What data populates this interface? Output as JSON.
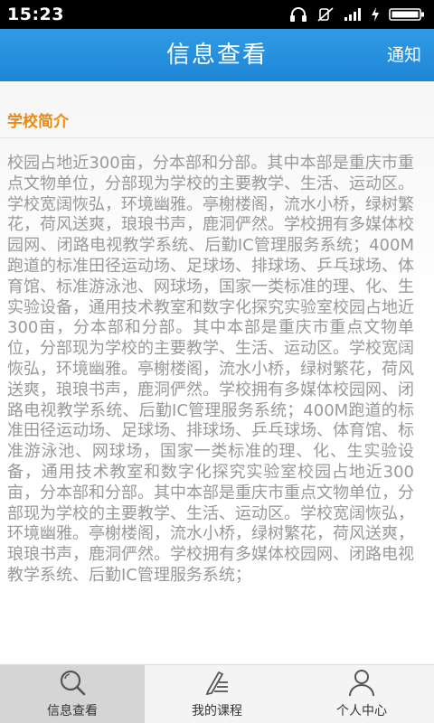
{
  "status_bar": {
    "time": "15:23",
    "icons": [
      "headphones-icon",
      "mute-icon",
      "signal-icon",
      "charging-icon",
      "battery-icon"
    ]
  },
  "header": {
    "title": "信息查看",
    "notify_label": "通知"
  },
  "section": {
    "title": "学校简介",
    "title_color": "#e88a14",
    "text": "校园占地近300亩，分本部和分部。其中本部是重庆市重点文物单位，分部现为学校的主要教学、生活、运动区。学校宽阔恢弘，环境幽雅。亭榭楼阁，流水小桥，绿树繁花，荷风送爽，琅琅书声，鹿洞俨然。学校拥有多媒体校园网、闭路电视教学系统、后勤IC管理服务系统；400M跑道的标准田径运动场、足球场、排球场、乒乓球场、体育馆、标准游泳池、网球场，国家一类标准的理、化、生实验设备，通用技术教室和数字化探究实验室校园占地近300亩，分本部和分部。其中本部是重庆市重点文物单位，分部现为学校的主要教学、生活、运动区。学校宽阔恢弘，环境幽雅。亭榭楼阁，流水小桥，绿树繁花，荷风送爽，琅琅书声，鹿洞俨然。学校拥有多媒体校园网、闭路电视教学系统、后勤IC管理服务系统；400M跑道的标准田径运动场、足球场、排球场、乒乓球场、体育馆、标准游泳池、网球场，国家一类标准的理、化、生实验设备，通用技术教室和数字化探究实验室校园占地近300亩，分本部和分部。其中本部是重庆市重点文物单位，分部现为学校的主要教学、生活、运动区。学校宽阔恢弘，环境幽雅。亭榭楼阁，流水小桥，绿树繁花，荷风送爽，琅琅书声，鹿洞俨然。学校拥有多媒体校园网、闭路电视教学系统、后勤IC管理服务系统；"
  },
  "bottom_nav": {
    "items": [
      {
        "label": "信息查看",
        "icon": "search-icon",
        "active": true
      },
      {
        "label": "我的课程",
        "icon": "course-edit-icon",
        "active": false
      },
      {
        "label": "个人中心",
        "icon": "person-icon",
        "active": false
      }
    ]
  },
  "colors": {
    "header": "#2f9be6",
    "status_bar": "#000000",
    "text_gray": "#999999"
  }
}
